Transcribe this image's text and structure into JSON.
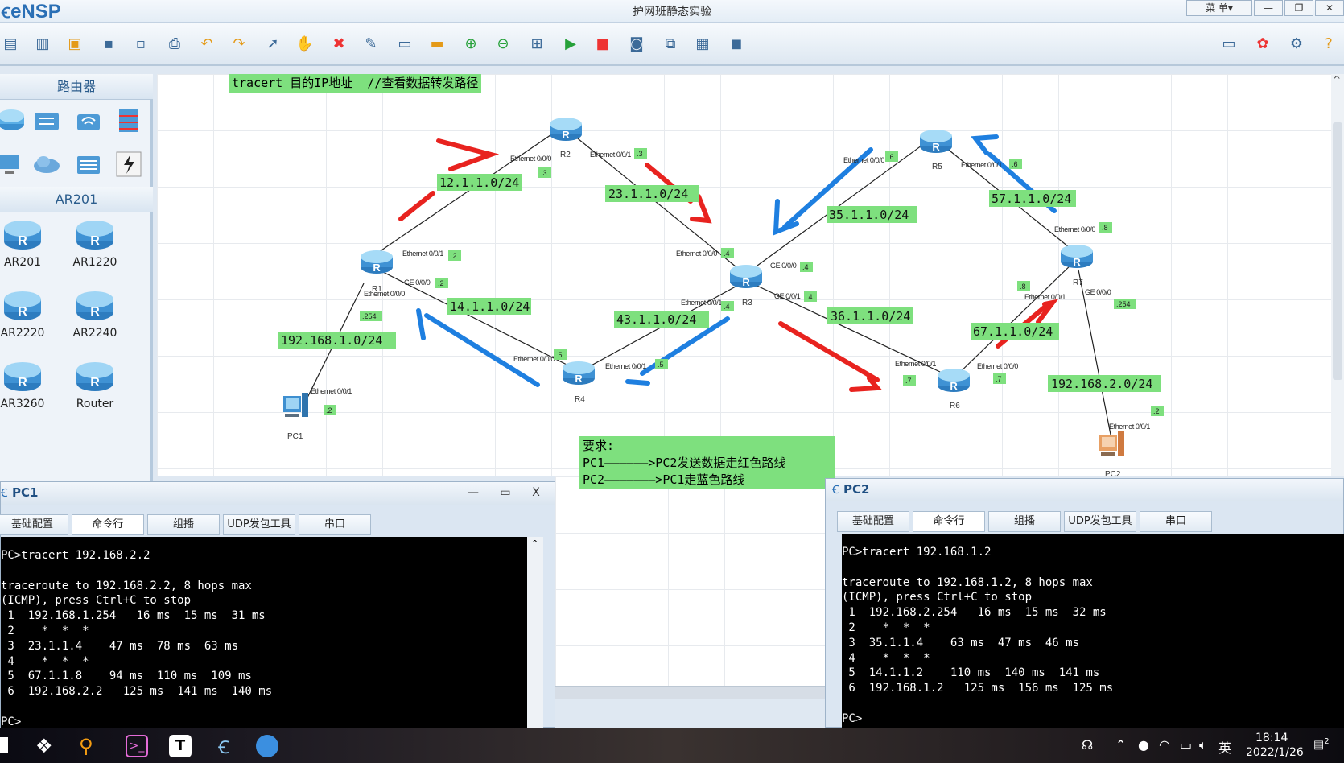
{
  "app": {
    "logo": "eNSP",
    "window_title": "护网班静态实验",
    "menu": "菜 单▾"
  },
  "palette": {
    "router_header": "路由器",
    "ar201_header": "AR201",
    "devices": [
      "AR201",
      "AR1220",
      "AR2220",
      "AR2240",
      "AR3260",
      "Router"
    ]
  },
  "topology": {
    "note_top": "tracert 目的IP地址  //查看数据转发路径",
    "requirements": {
      "title": "要求:",
      "line1": "PC1——————>PC2发送数据走红色路线",
      "line2": "PC2———————>PC1走蓝色路线"
    },
    "networks": {
      "n12": "12.1.1.0/24",
      "n23": "23.1.1.0/24",
      "n35": "35.1.1.0/24",
      "n57": "57.1.1.0/24",
      "n14": "14.1.1.0/24",
      "n43": "43.1.1.0/24",
      "n36": "36.1.1.0/24",
      "n67": "67.1.1.0/24",
      "lan1": "192.168.1.0/24",
      "lan2": "192.168.2.0/24"
    },
    "devices": {
      "r1": "R1",
      "r2": "R2",
      "r3": "R3",
      "r4": "R4",
      "r5": "R5",
      "r6": "R6",
      "r7": "R7",
      "pc1": "PC1",
      "pc2": "PC2"
    },
    "ports": {
      "eth000": "Ethernet 0/0/0",
      "eth001": "Ethernet 0/0/1",
      "ge000": "GE 0/0/0",
      "ge001": "GE 0/0/1"
    },
    "hosts": {
      "h2": ".2",
      "h3": ".3",
      "h4": ".4",
      "h5": ".5",
      "h6": ".6",
      "h7": ".7",
      "h8": ".8",
      "h254": ".254"
    }
  },
  "pc1": {
    "title": "PC1",
    "tabs": [
      "基础配置",
      "命令行",
      "组播",
      "UDP发包工具",
      "串口"
    ],
    "active_tab": "命令行",
    "console": [
      "PC>tracert 192.168.2.2",
      "",
      "traceroute to 192.168.2.2, 8 hops max",
      "(ICMP), press Ctrl+C to stop",
      " 1  192.168.1.254   16 ms  15 ms  31 ms",
      " 2    *  *  *",
      " 3  23.1.1.4    47 ms  78 ms  63 ms",
      " 4    *  *  *",
      " 5  67.1.1.8    94 ms  110 ms  109 ms",
      " 6  192.168.2.2   125 ms  141 ms  140 ms",
      "",
      "PC>"
    ]
  },
  "pc2": {
    "title": "PC2",
    "tabs": [
      "基础配置",
      "命令行",
      "组播",
      "UDP发包工具",
      "串口"
    ],
    "active_tab": "命令行",
    "console": [
      "PC>tracert 192.168.1.2",
      "",
      "traceroute to 192.168.1.2, 8 hops max",
      "(ICMP), press Ctrl+C to stop",
      " 1  192.168.2.254   16 ms  15 ms  32 ms",
      " 2    *  *  *",
      " 3  35.1.1.4    63 ms  47 ms  46 ms",
      " 4    *  *  *",
      " 5  14.1.1.2    110 ms  140 ms  141 ms",
      " 6  192.168.1.2   125 ms  156 ms  125 ms",
      "",
      "PC>"
    ]
  },
  "taskbar": {
    "ime": "英",
    "time": "18:14",
    "date": "2022/1/26",
    "notifications": "2"
  },
  "colors": {
    "red_route": "#e8231f",
    "blue_route": "#1e7fe0",
    "label_bg": "#7ee07e"
  }
}
